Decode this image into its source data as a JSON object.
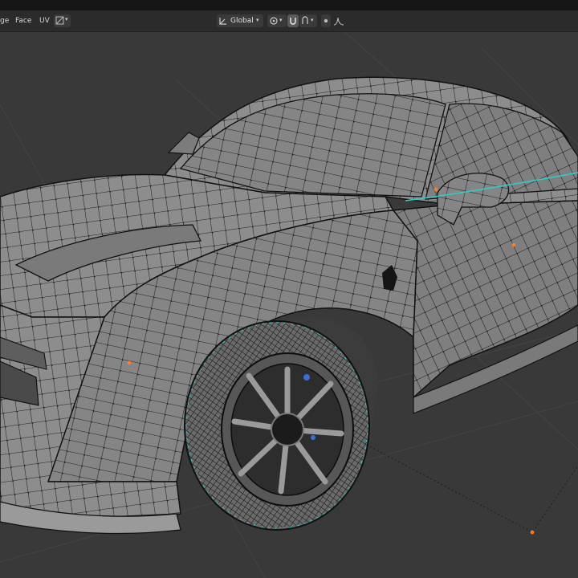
{
  "header": {
    "menus": [
      "ge",
      "Face",
      "UV"
    ],
    "transform_orientation": "Global"
  },
  "colors": {
    "viewport_bg": "#393939",
    "mesh_face": "#8e8e8e",
    "mesh_edge": "#111111",
    "selected_vertex": "#ff7a1a",
    "seam": "#33c9c9"
  },
  "icons": [
    "uv-sync-icon",
    "transform-orientation-icon",
    "pivot-icon",
    "snap-icon",
    "proportional-editing-icon",
    "falloff-icon"
  ]
}
